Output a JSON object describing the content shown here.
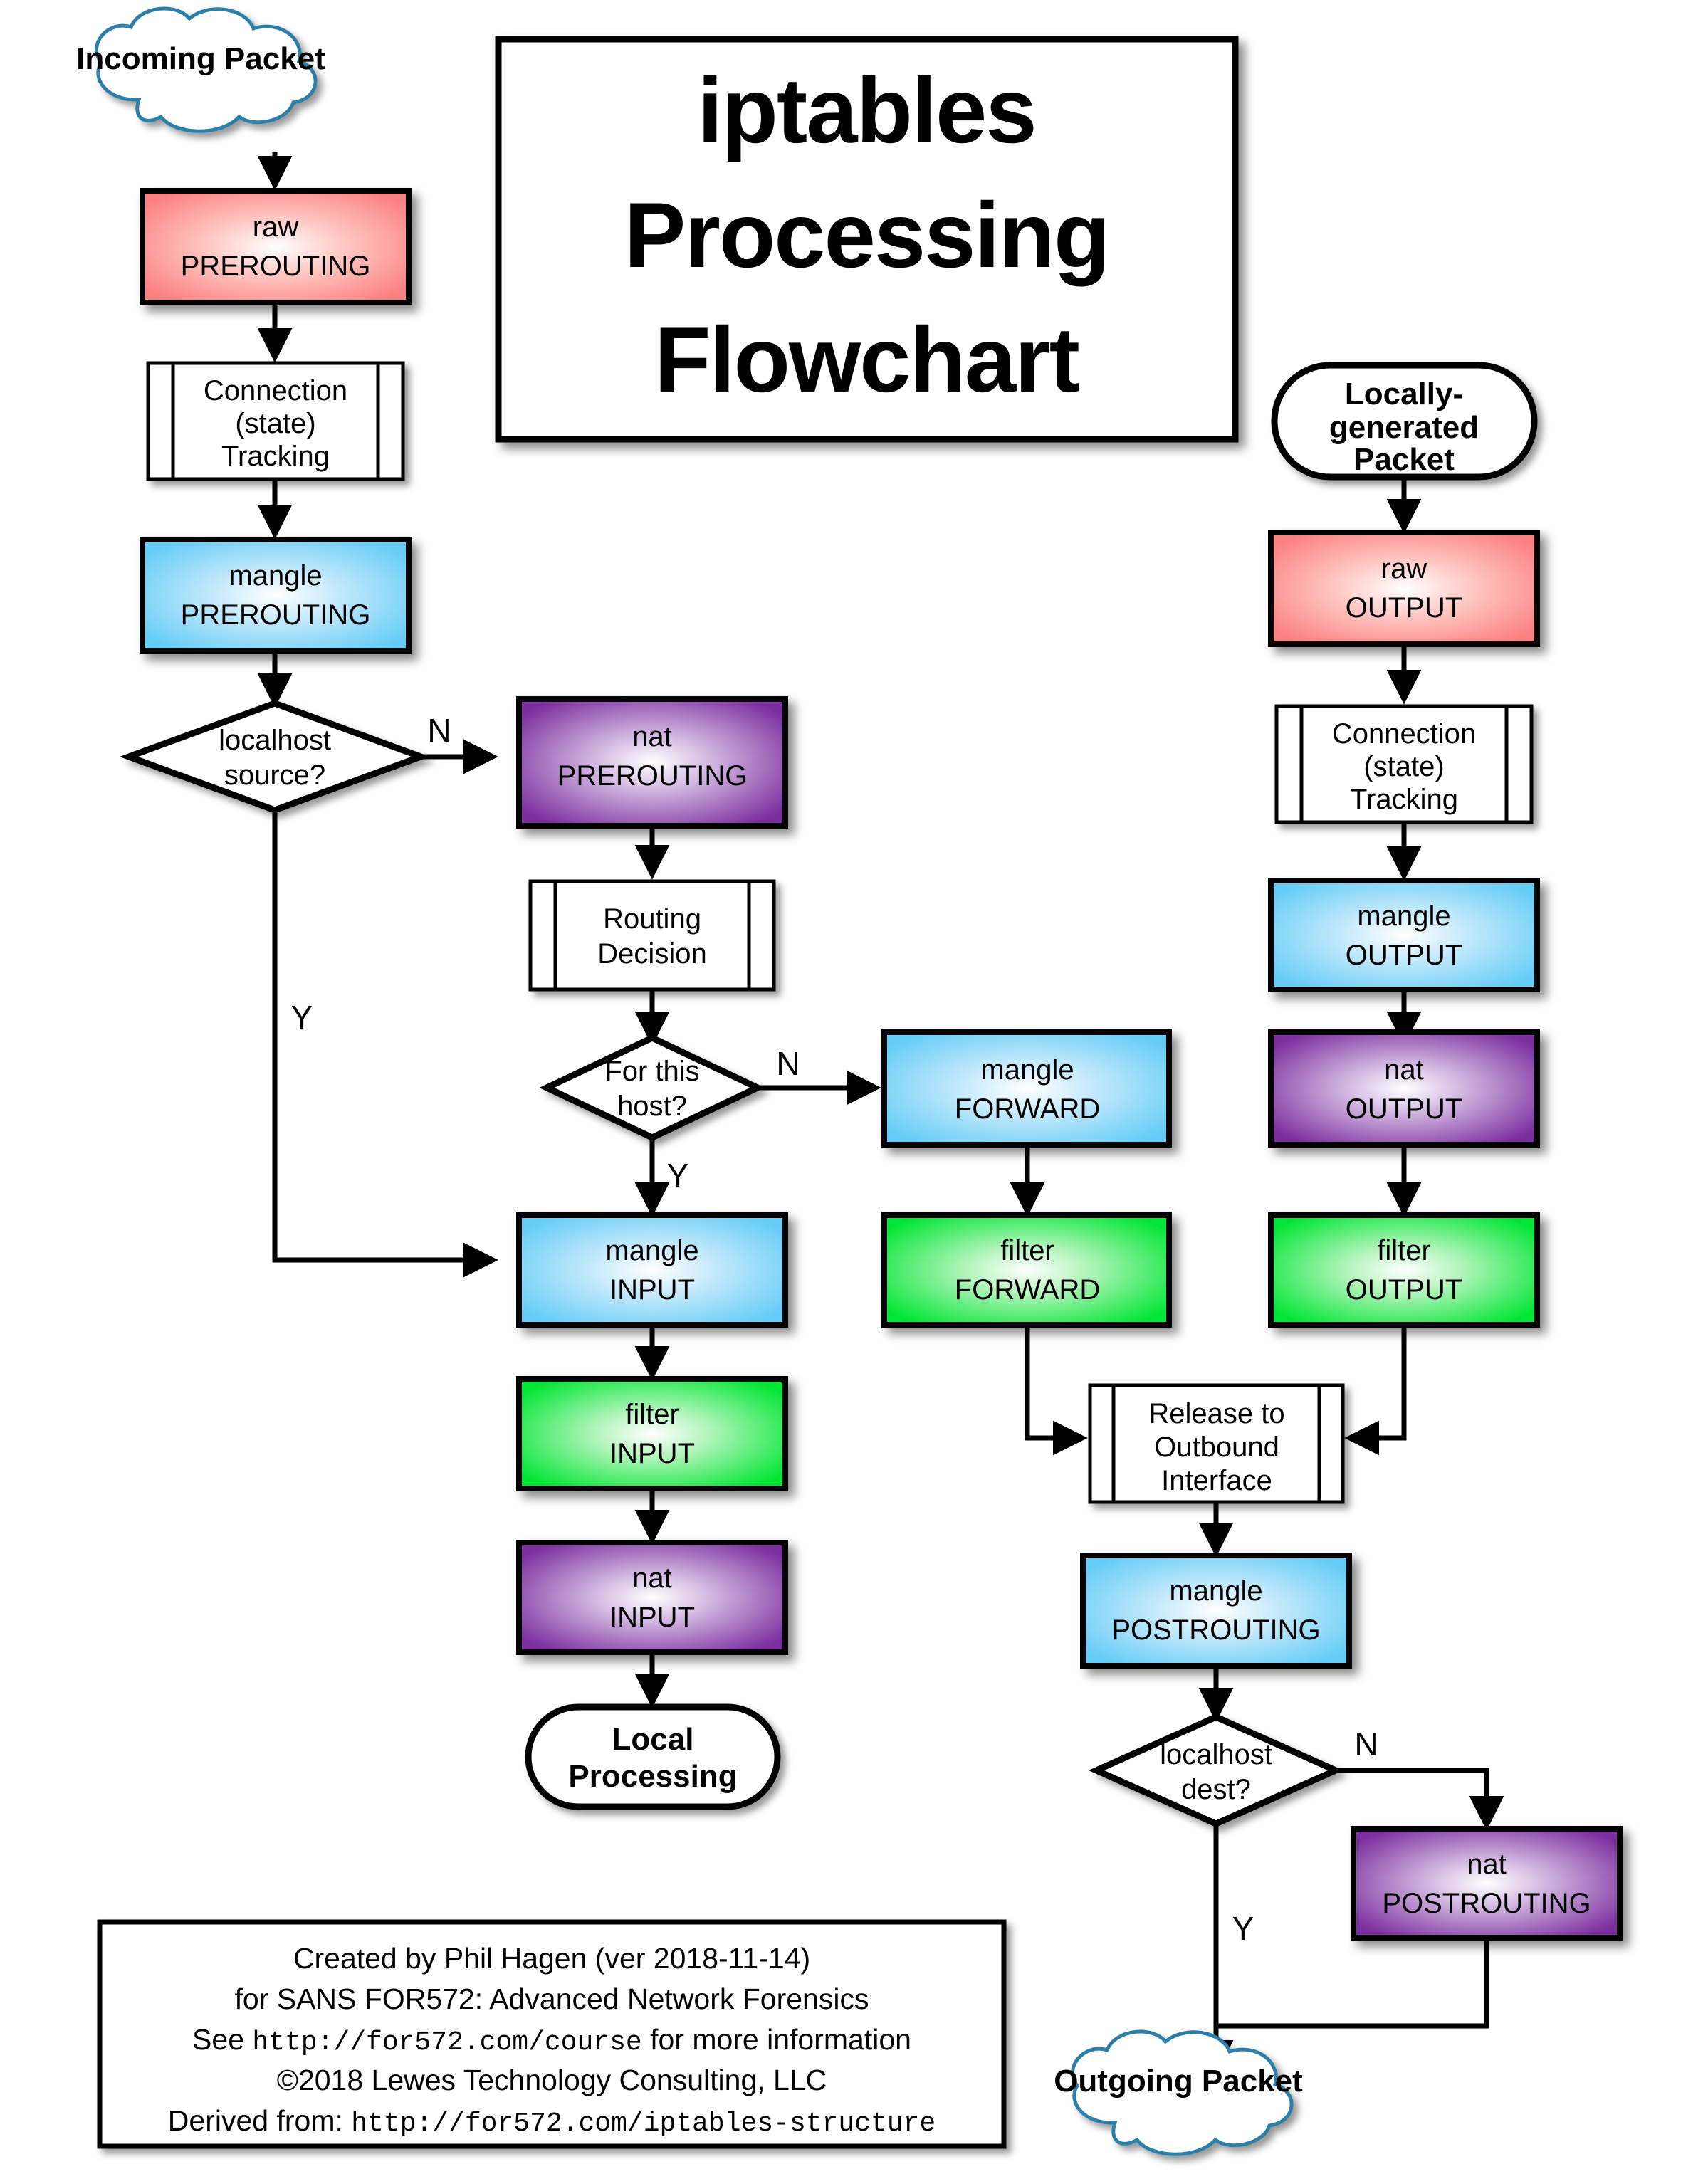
{
  "title": {
    "line1": "iptables",
    "line2": "Processing",
    "line3": "Flowchart"
  },
  "terminals": {
    "incoming": "Incoming Packet",
    "outgoing": "Outgoing Packet",
    "local_processing_l1": "Local",
    "local_processing_l2": "Processing",
    "locally_generated_l1": "Locally-",
    "locally_generated_l2": "generated",
    "locally_generated_l3": "Packet"
  },
  "colors": {
    "raw": "#FF8080",
    "mangle": "#66CCF5",
    "nat": "#7B2D9E",
    "filter": "#00E633",
    "cloud_stroke": "#2E7FA8",
    "border": "#000000"
  },
  "nodes": {
    "raw_prerouting": {
      "table": "raw",
      "chain": "PREROUTING",
      "color_key": "raw"
    },
    "conntrack_in": {
      "l1": "Connection",
      "l2": "(state)",
      "l3": "Tracking"
    },
    "mangle_prerouting": {
      "table": "mangle",
      "chain": "PREROUTING",
      "color_key": "mangle"
    },
    "localhost_source": {
      "l1": "localhost",
      "l2": "source?"
    },
    "nat_prerouting": {
      "table": "nat",
      "chain": "PREROUTING",
      "color_key": "nat"
    },
    "routing_decision": {
      "l1": "Routing",
      "l2": "Decision"
    },
    "for_this_host": {
      "l1": "For this",
      "l2": "host?"
    },
    "mangle_forward": {
      "table": "mangle",
      "chain": "FORWARD",
      "color_key": "mangle"
    },
    "mangle_input": {
      "table": "mangle",
      "chain": "INPUT",
      "color_key": "mangle"
    },
    "filter_forward": {
      "table": "filter",
      "chain": "FORWARD",
      "color_key": "filter"
    },
    "filter_input": {
      "table": "filter",
      "chain": "INPUT",
      "color_key": "filter"
    },
    "nat_input": {
      "table": "nat",
      "chain": "INPUT",
      "color_key": "nat"
    },
    "raw_output": {
      "table": "raw",
      "chain": "OUTPUT",
      "color_key": "raw"
    },
    "conntrack_out": {
      "l1": "Connection",
      "l2": "(state)",
      "l3": "Tracking"
    },
    "mangle_output": {
      "table": "mangle",
      "chain": "OUTPUT",
      "color_key": "mangle"
    },
    "nat_output": {
      "table": "nat",
      "chain": "OUTPUT",
      "color_key": "nat"
    },
    "filter_output": {
      "table": "filter",
      "chain": "OUTPUT",
      "color_key": "filter"
    },
    "release_outbound": {
      "l1": "Release to",
      "l2": "Outbound",
      "l3": "Interface"
    },
    "mangle_postrouting": {
      "table": "mangle",
      "chain": "POSTROUTING",
      "color_key": "mangle"
    },
    "localhost_dest": {
      "l1": "localhost",
      "l2": "dest?"
    },
    "nat_postrouting": {
      "table": "nat",
      "chain": "POSTROUTING",
      "color_key": "nat"
    }
  },
  "edge_labels": {
    "localhost_source_n": "N",
    "localhost_source_y": "Y",
    "for_this_host_n": "N",
    "for_this_host_y": "Y",
    "localhost_dest_n": "N",
    "localhost_dest_y": "Y"
  },
  "footer": {
    "line1": "Created by Phil Hagen (ver 2018-11-14)",
    "line2": "for SANS FOR572: Advanced Network Forensics",
    "line3_pre": "See ",
    "line3_url": "http://for572.com/course",
    "line3_post": " for more information",
    "line4": "©2018 Lewes Technology Consulting, LLC",
    "line5_pre": "Derived from: ",
    "line5_url": "http://for572.com/iptables-structure"
  }
}
